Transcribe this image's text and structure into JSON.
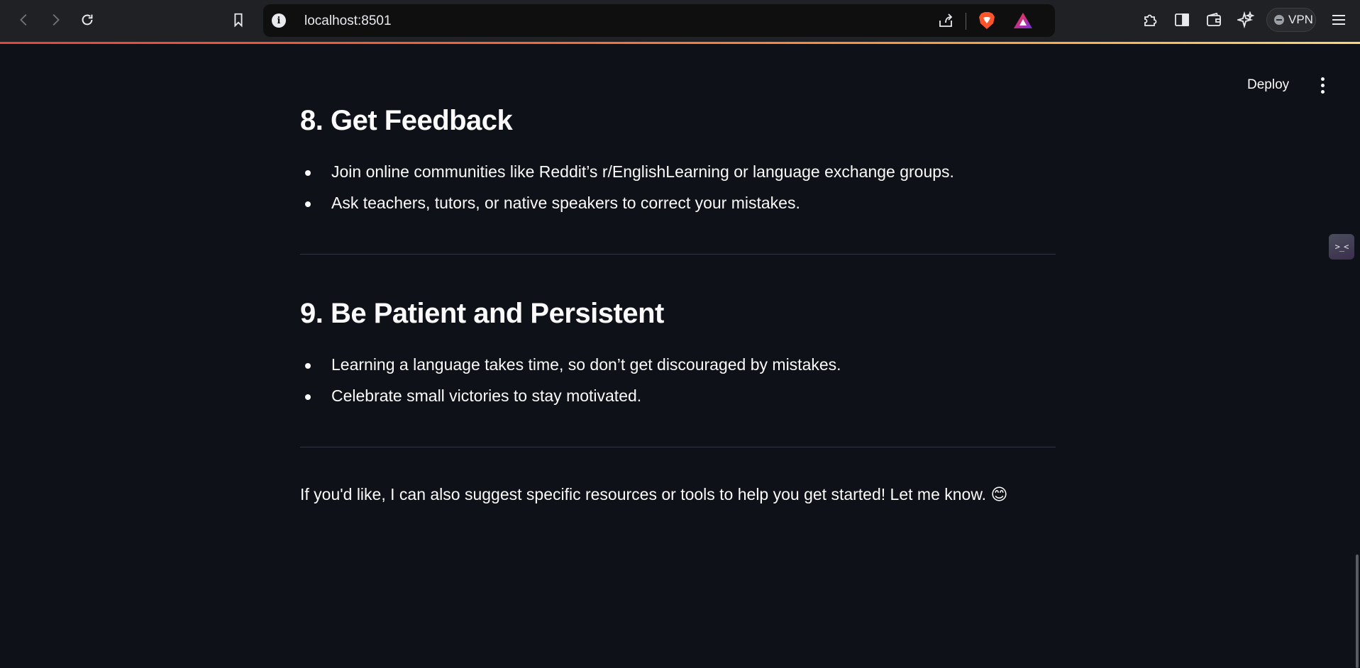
{
  "browser": {
    "url": "localhost:8501",
    "vpn_label": "VPN",
    "icons": {
      "back": "back-arrow-icon",
      "forward": "forward-arrow-icon",
      "reload": "reload-icon",
      "bookmark": "bookmark-icon",
      "site_info": "info-icon",
      "share": "share-icon",
      "brave_shields": "brave-lion-icon",
      "brave_rewards": "brave-rewards-triangle-icon",
      "extensions": "puzzle-icon",
      "sidebar": "sidebar-panel-icon",
      "wallet": "wallet-icon",
      "leo": "sparkle-icon",
      "menu": "hamburger-icon"
    }
  },
  "app": {
    "deploy_label": "Deploy",
    "side_widget_label": ">_<"
  },
  "content": {
    "sections": [
      {
        "title": "8. Get Feedback",
        "bullets": [
          "Join online communities like Reddit’s r/EnglishLearning or language exchange groups.",
          "Ask teachers, tutors, or native speakers to correct your mistakes."
        ]
      },
      {
        "title": "9. Be Patient and Persistent",
        "bullets": [
          "Learning a language takes time, so don’t get discouraged by mistakes.",
          "Celebrate small victories to stay motivated."
        ]
      }
    ],
    "closing": "If you'd like, I can also suggest specific resources or tools to help you get started! Let me know. 😊"
  },
  "colors": {
    "page_bg": "#0e1117",
    "chrome_bg": "#202124",
    "omnibox_bg": "#0f0f10",
    "text": "#fafafa",
    "divider": "#31333f"
  }
}
